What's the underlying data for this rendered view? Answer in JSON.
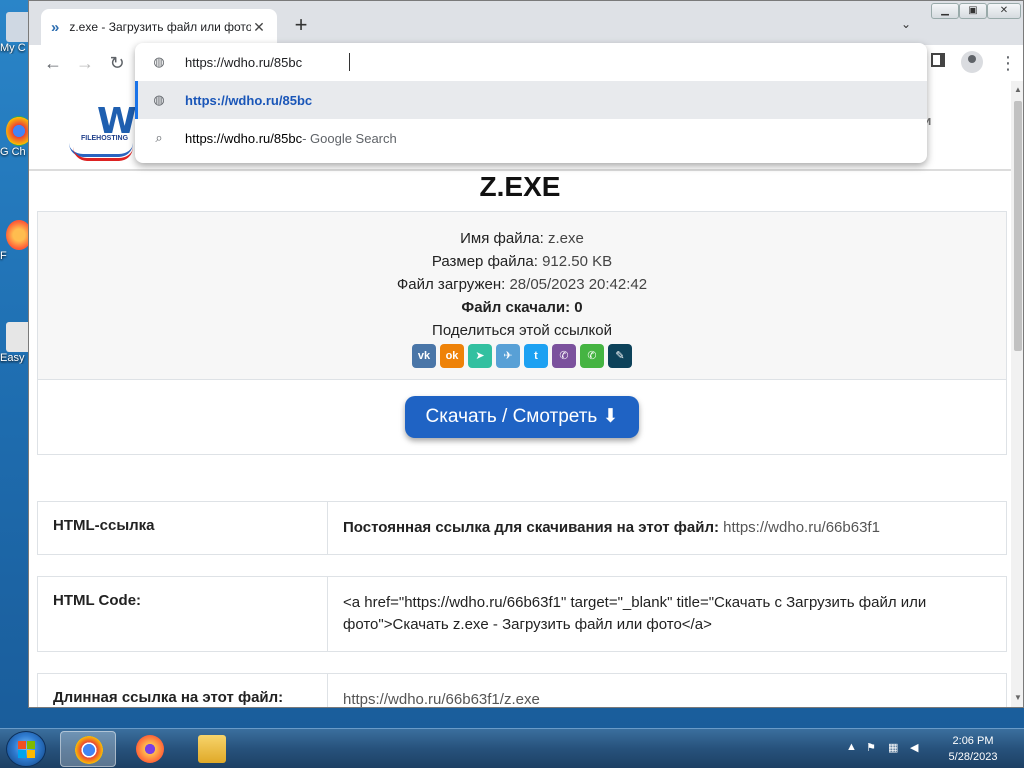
{
  "desktop": {
    "icons": [
      {
        "label": "My C",
        "icon": "computer-icon"
      },
      {
        "label": "G Ch",
        "icon": "chrome-icon"
      },
      {
        "label": "F",
        "icon": "firefox-icon"
      },
      {
        "label": "Easy",
        "icon": "easy-icon"
      }
    ]
  },
  "browser": {
    "tab_title": "z.exe - Загрузить файл или фото",
    "tab_close": "✕",
    "new_tab": "+",
    "tab_menu": "⌄",
    "omnibox": {
      "input_value": "https://wdho.ru/85bc",
      "suggestions": [
        {
          "text": "https://wdho.ru/85bc",
          "icon": "globe-icon"
        },
        {
          "text": "https://wdho.ru/85bc",
          "suffix": " - Google Search",
          "icon": "search-icon"
        }
      ]
    }
  },
  "site": {
    "login_label": "йти",
    "logo_text": "FILEHOSTING",
    "file_title": "Z.EXE",
    "info": {
      "name_label": "Имя файла:",
      "name_value": "z.exe",
      "size_label": "Размер файла:",
      "size_value": "912.50 KB",
      "uploaded_label": "Файл загружен:",
      "uploaded_value": "28/05/2023 20:42:42",
      "downloads_label": "Файл скачали:",
      "downloads_value": "0",
      "share_label": "Поделиться этой ссылкой"
    },
    "share_icons": [
      {
        "name": "vk-icon",
        "text": "vk",
        "color": "#4a76a8"
      },
      {
        "name": "odnoklassniki-icon",
        "text": "ok",
        "color": "#ee8208"
      },
      {
        "name": "share-arrow-icon",
        "text": "➤",
        "color": "#32c0a0"
      },
      {
        "name": "telegram-icon",
        "text": "✈",
        "color": "#58a0d6"
      },
      {
        "name": "twitter-icon",
        "text": "t",
        "color": "#1da1f2"
      },
      {
        "name": "viber-icon",
        "text": "✆",
        "color": "#7b519d"
      },
      {
        "name": "whatsapp-icon",
        "text": "✆",
        "color": "#45b442"
      },
      {
        "name": "livejournal-icon",
        "text": "✎",
        "color": "#0d425a"
      }
    ],
    "download_button": "Скачать / Смотреть",
    "rows": [
      {
        "label": "HTML-ссылка",
        "value_bold": "Постоянная ссылка для скачивания на этот файл:",
        "value": " https://wdho.ru/66b63f1"
      },
      {
        "label": "HTML Code:",
        "value_bold": "",
        "value": "<a href=\"https://wdho.ru/66b63f1\" target=\"_blank\" title=\"Скачать с Загрузить файл или фото\">Скачать z.exe - Загрузить файл или фото</a>"
      },
      {
        "label": "Длинная ссылка на этот файл:",
        "value_bold": "",
        "value": "https://wdho.ru/66b63f1/z.exe"
      }
    ]
  },
  "taskbar": {
    "time": "2:06 PM",
    "date": "5/28/2023"
  },
  "colors": {
    "accent": "#1f63c4",
    "selected_suggestion": "#1a56b8"
  }
}
